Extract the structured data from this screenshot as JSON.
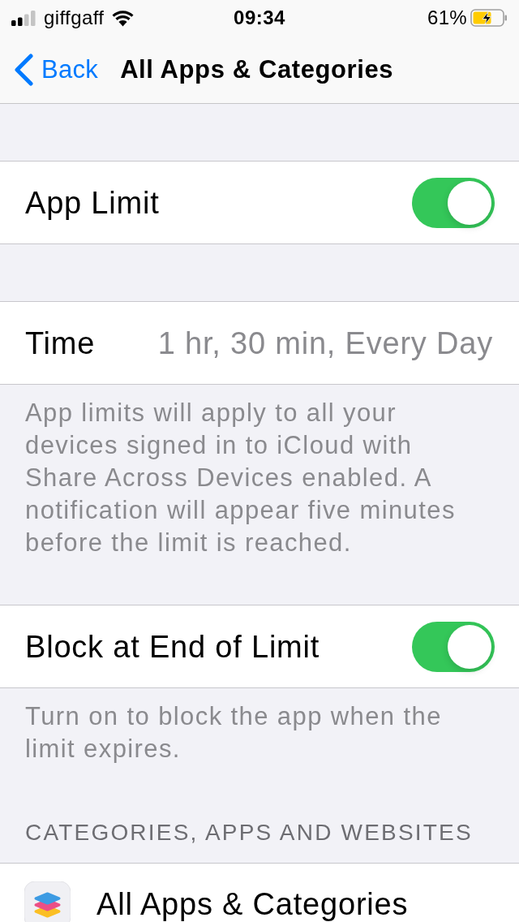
{
  "status_bar": {
    "carrier": "giffgaff",
    "time": "09:34",
    "battery": "61%",
    "charging": true
  },
  "nav_bar": {
    "back": "Back",
    "title": "All Apps & Categories"
  },
  "sections": [
    {
      "rows": [
        {
          "kind": "toggle",
          "label": "App Limit",
          "on": true
        }
      ]
    },
    {
      "rows": [
        {
          "kind": "value",
          "label": "Time",
          "value": "1 hr, 30 min, Every Day"
        }
      ],
      "footer": "App limits will apply to all your devices signed in to iCloud with Share Across Devices enabled. A notification will appear five minutes before the limit is reached."
    },
    {
      "rows": [
        {
          "kind": "toggle",
          "label": "Block at End of Limit",
          "on": true
        }
      ],
      "footer": "Turn on to block the app when the limit expires."
    },
    {
      "header": "CATEGORIES, APPS AND WEBSITES",
      "rows": [
        {
          "kind": "app",
          "label": "All Apps & Categories"
        }
      ]
    }
  ]
}
